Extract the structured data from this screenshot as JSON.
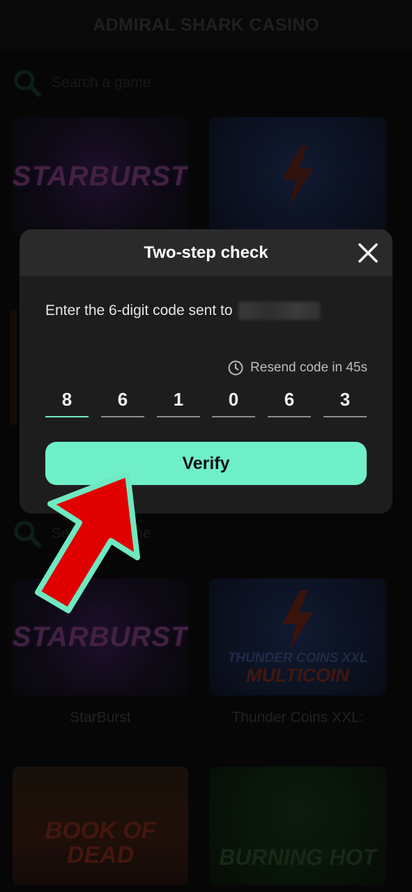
{
  "app": {
    "title": "ADMIRAL SHARK CASINO",
    "search_placeholder": "Search a game"
  },
  "games": [
    {
      "name": "StarBurst",
      "art_text": "STARBURST"
    },
    {
      "name": "Thunder Coins XXL:",
      "art_text_top": "THUNDER COINS XXL",
      "art_text_bottom": "MULTICOIN"
    },
    {
      "name": "Book of Dead",
      "art_text": "BOOK OF DEAD"
    },
    {
      "name": "Burning Hot",
      "art_text": "BURNING HOT"
    }
  ],
  "modal": {
    "title": "Two-step check",
    "prompt": "Enter the 6-digit code sent to",
    "resend_text": "Resend code in 45s",
    "code_digits": [
      "8",
      "6",
      "1",
      "0",
      "6",
      "3"
    ],
    "verify_label": "Verify"
  },
  "colors": {
    "accent": "#6ff0c8",
    "arrow_fill": "#e00000",
    "arrow_outline": "#6fe9c2",
    "modal_bg": "#1d1d1d",
    "modal_header_bg": "#2a2a2a"
  },
  "icons": [
    "search-icon",
    "close-icon",
    "clock-icon",
    "lightning-icon"
  ]
}
